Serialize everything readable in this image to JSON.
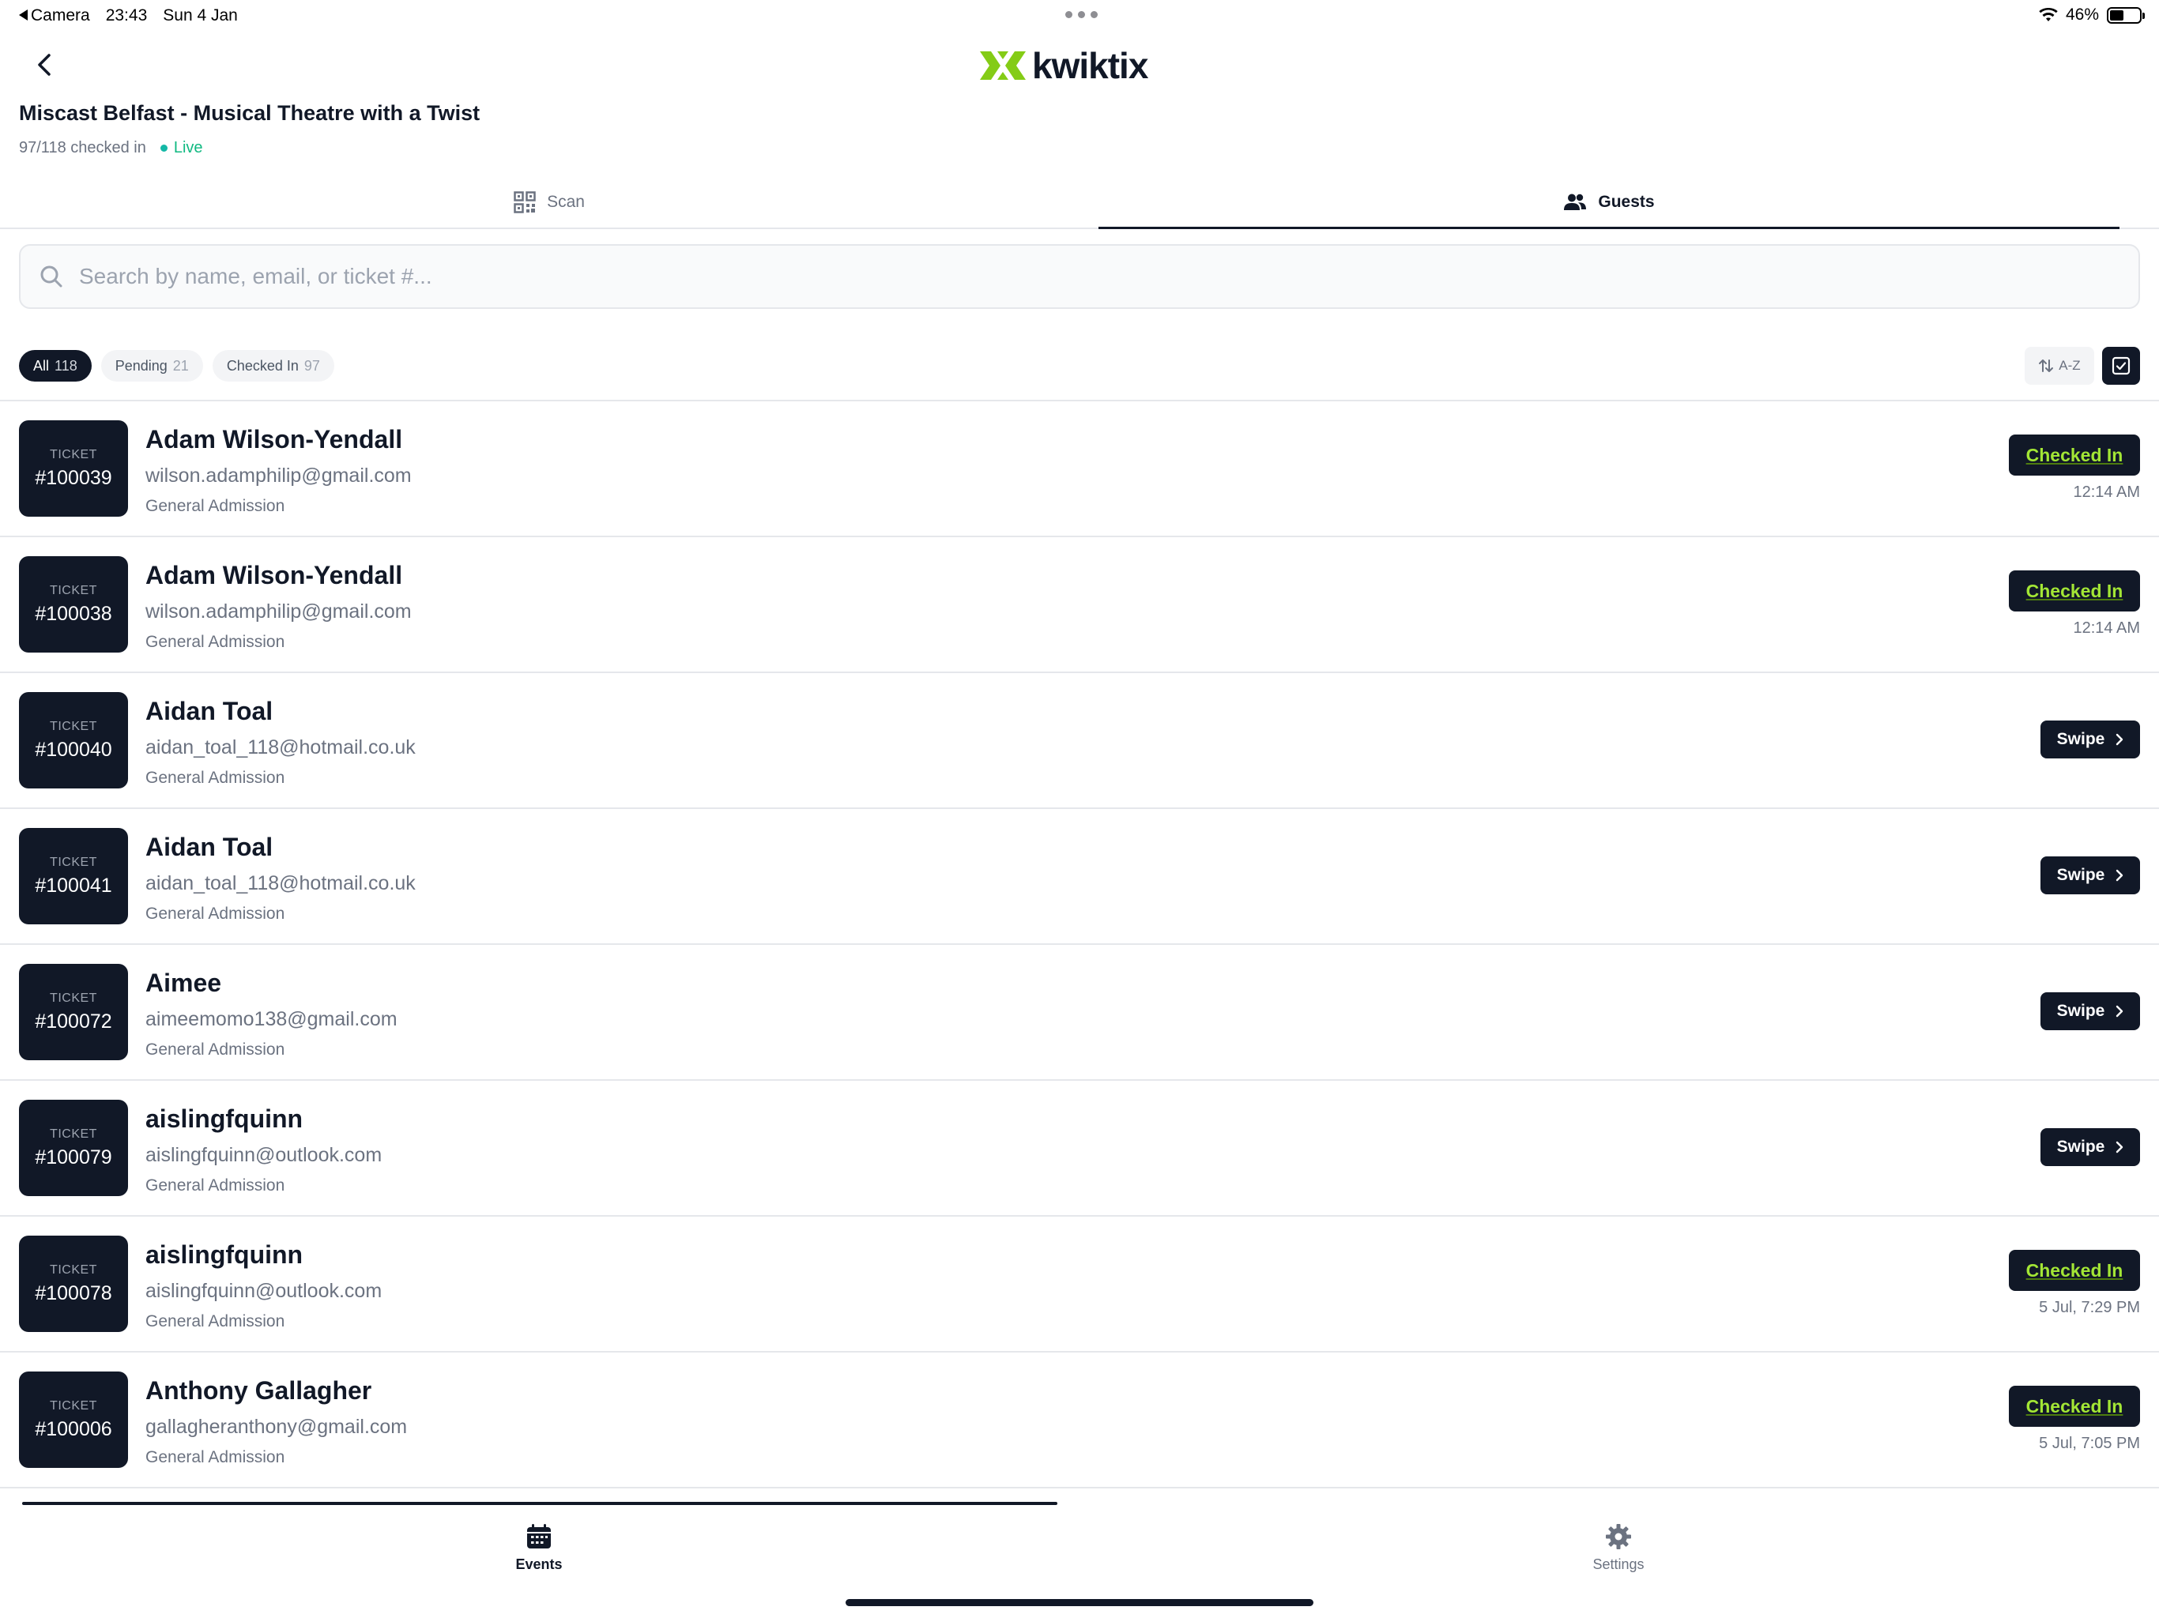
{
  "status_bar": {
    "back_app": "Camera",
    "time": "23:43",
    "date": "Sun 4 Jan",
    "battery": "46%",
    "battery_level": 0.46
  },
  "header": {
    "logo_text": "kwiktix",
    "brand_color": "#84cc16",
    "event_title": "Miscast Belfast - Musical Theatre with a Twist",
    "checked_in_summary": "97/118 checked in",
    "live_label": "Live"
  },
  "tabs": {
    "scan": "Scan",
    "guests": "Guests"
  },
  "search": {
    "placeholder": "Search by name, email, or ticket #..."
  },
  "filters": [
    {
      "label": "All",
      "count": "118",
      "active": true
    },
    {
      "label": "Pending",
      "count": "21",
      "active": false
    },
    {
      "label": "Checked In",
      "count": "97",
      "active": false
    }
  ],
  "sort_label": "A-Z",
  "ticket_label": "TICKET",
  "guests": [
    {
      "ticket": "#100039",
      "name": "Adam Wilson-Yendall",
      "email": "wilson.adamphilip@gmail.com",
      "type": "General Admission",
      "status": "Checked In",
      "time": "12:14 AM"
    },
    {
      "ticket": "#100038",
      "name": "Adam Wilson-Yendall",
      "email": "wilson.adamphilip@gmail.com",
      "type": "General Admission",
      "status": "Checked In",
      "time": "12:14 AM"
    },
    {
      "ticket": "#100040",
      "name": "Aidan Toal",
      "email": "aidan_toal_118@hotmail.co.uk",
      "type": "General Admission",
      "status": "Swipe",
      "time": ""
    },
    {
      "ticket": "#100041",
      "name": "Aidan Toal",
      "email": "aidan_toal_118@hotmail.co.uk",
      "type": "General Admission",
      "status": "Swipe",
      "time": ""
    },
    {
      "ticket": "#100072",
      "name": "Aimee",
      "email": "aimeemomo138@gmail.com",
      "type": "General Admission",
      "status": "Swipe",
      "time": ""
    },
    {
      "ticket": "#100079",
      "name": "aislingfquinn",
      "email": "aislingfquinn@outlook.com",
      "type": "General Admission",
      "status": "Swipe",
      "time": ""
    },
    {
      "ticket": "#100078",
      "name": "aislingfquinn",
      "email": "aislingfquinn@outlook.com",
      "type": "General Admission",
      "status": "Checked In",
      "time": "5 Jul, 7:29 PM"
    },
    {
      "ticket": "#100006",
      "name": "Anthony Gallagher",
      "email": "gallagheranthony@gmail.com",
      "type": "General Admission",
      "status": "Checked In",
      "time": "5 Jul, 7:05 PM"
    }
  ],
  "bottom_nav": {
    "events": "Events",
    "settings": "Settings"
  }
}
